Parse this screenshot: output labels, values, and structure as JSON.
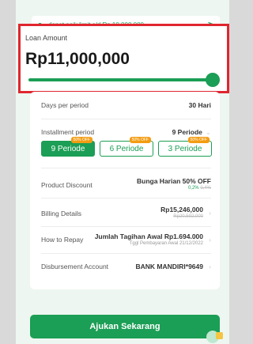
{
  "banner": {
    "text": "dapat naik limit s/d Rp 10.000.000",
    "chevron": ">"
  },
  "loan": {
    "label": "Loan Amount",
    "value": "Rp11,000,000",
    "slider_fraction": 1.0
  },
  "rows": {
    "days_per_period": {
      "label": "Days per period",
      "value": "30 Hari"
    },
    "installment_period": {
      "label": "Installment period",
      "value": "9 Periode"
    },
    "product_discount": {
      "label": "Product Discount",
      "value": "Bunga Harian 50% OFF",
      "new_rate": "0,2%",
      "old_rate": "0,4%"
    },
    "billing_details": {
      "label": "Billing Details",
      "value": "Rp15,246,000",
      "old_value": "Rp20,592,000"
    },
    "how_to_repay": {
      "label": "How to Repay",
      "value": "Jumlah Tagihan Awal Rp1.694.000",
      "sub": "Tggl Pembayaran Awal 21/12/2022"
    },
    "disbursement": {
      "label": "Disbursement Account",
      "value": "BANK MANDIRI*9649"
    }
  },
  "period_options": [
    {
      "label": "9 Periode",
      "badge": "50% OFF",
      "selected": true
    },
    {
      "label": "6 Periode",
      "badge": "50% OFF",
      "selected": false
    },
    {
      "label": "3 Periode",
      "badge": "50% OFF",
      "selected": false
    }
  ],
  "submit_label": "Ajukan Sekarang",
  "colors": {
    "accent": "#1b9e55",
    "highlight_border": "#e0262e",
    "badge": "#f39c12"
  }
}
